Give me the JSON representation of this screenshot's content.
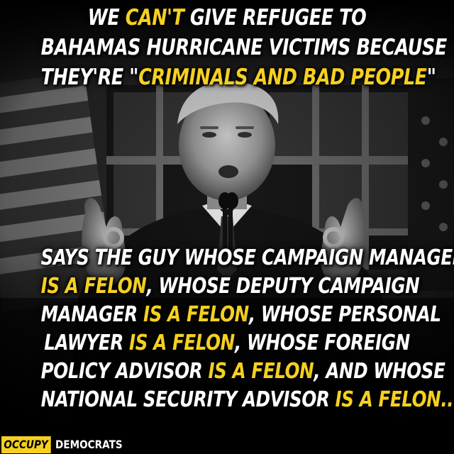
{
  "top_caption": {
    "line1": {
      "pre": "We ",
      "hl": "can't",
      "post": " give refugee to"
    },
    "line2": "Bahamas hurricane victims because",
    "line3": {
      "pre": "they're \"",
      "hl": "criminals and bad people",
      "post": "\""
    }
  },
  "bottom_caption": {
    "line1": "Says the guy whose campaign manager",
    "line2": {
      "hl": "is a felon",
      "post": ", whose deputy campaign"
    },
    "line3": {
      "pre": "manager ",
      "hl": "is a felon",
      "post": ", whose personal"
    },
    "line4": {
      "pre": "lawyer ",
      "hl": "is a felon",
      "post": ", whose foreign"
    },
    "line5": {
      "pre": "policy advisor ",
      "hl": "is a felon",
      "post": ", and whose"
    },
    "line6": {
      "pre": "national security advisor ",
      "hl": "is a felon..."
    }
  },
  "brand": {
    "part1": "OCCUPY",
    "part2": "DEMOCRATS"
  },
  "colors": {
    "background": "#000000",
    "text": "#ffffff",
    "highlight": "#f5d020"
  }
}
